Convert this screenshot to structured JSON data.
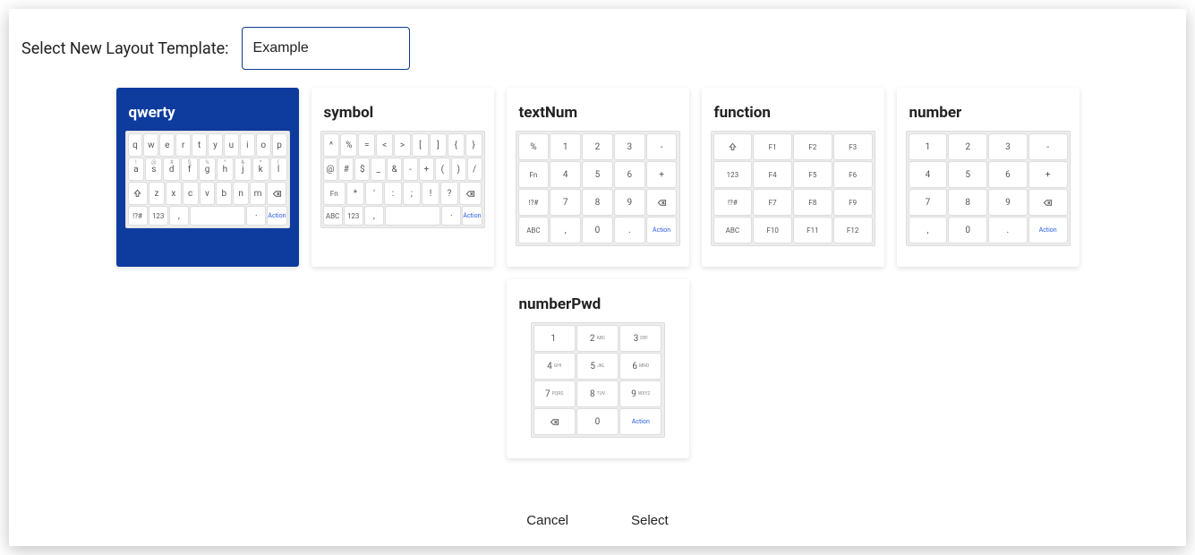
{
  "header": {
    "label": "Select New Layout Template:",
    "input_value": "Example"
  },
  "templates": {
    "qwerty": {
      "title": "qwerty",
      "selected": true,
      "rows": [
        [
          "q",
          "w",
          "e",
          "r",
          "t",
          "y",
          "u",
          "i",
          "o",
          "p"
        ],
        [
          "a",
          "s",
          "d",
          "f",
          "g",
          "h",
          "j",
          "k",
          "l"
        ],
        [
          "⇧",
          "z",
          "x",
          "c",
          "v",
          "b",
          "n",
          "m",
          "⌫"
        ],
        [
          "!?#",
          "123",
          ",",
          "",
          "·",
          "Action"
        ]
      ],
      "sup_row": [
        "!",
        "@",
        "#",
        "$",
        "%",
        "^",
        "&",
        "*",
        "(",
        ")"
      ]
    },
    "symbol": {
      "title": "symbol",
      "rows": [
        [
          "^",
          "%",
          "=",
          "<",
          ">",
          "[",
          "]",
          "{",
          "}"
        ],
        [
          "@",
          "#",
          "$",
          "_",
          "&",
          "-",
          "+",
          "(",
          ")",
          "/"
        ],
        [
          "Fn",
          "*",
          "'",
          ":",
          ";",
          "!",
          "?",
          "⌫"
        ],
        [
          "ABC",
          "123",
          ",",
          "",
          "·",
          "Action"
        ]
      ]
    },
    "textNum": {
      "title": "textNum",
      "rows": [
        [
          "%",
          "1",
          "2",
          "3",
          "-"
        ],
        [
          "Fn",
          "4",
          "5",
          "6",
          "+"
        ],
        [
          "!?#",
          "7",
          "8",
          "9",
          "⌫"
        ],
        [
          "ABC",
          ",",
          "0",
          ".",
          "Action"
        ]
      ]
    },
    "function": {
      "title": "function",
      "rows": [
        [
          "⇧",
          "F1",
          "F2",
          "F3"
        ],
        [
          "123",
          "F4",
          "F5",
          "F6"
        ],
        [
          "!?#",
          "F7",
          "F8",
          "F9"
        ],
        [
          "ABC",
          "F10",
          "F11",
          "F12"
        ]
      ]
    },
    "number": {
      "title": "number",
      "rows": [
        [
          "1",
          "2",
          "3",
          "-"
        ],
        [
          "4",
          "5",
          "6",
          "+"
        ],
        [
          "7",
          "8",
          "9",
          "⌫"
        ],
        [
          ",",
          "0",
          ".",
          "Action"
        ]
      ]
    },
    "numberPwd": {
      "title": "numberPwd",
      "rows": [
        [
          [
            "1",
            ""
          ],
          [
            "2",
            "ABC"
          ],
          [
            "3",
            "DEF"
          ]
        ],
        [
          [
            "4",
            "GHI"
          ],
          [
            "5",
            "JKL"
          ],
          [
            "6",
            "MNO"
          ]
        ],
        [
          [
            "7",
            "PQRS"
          ],
          [
            "8",
            "TUV"
          ],
          [
            "9",
            "WXYZ"
          ]
        ],
        [
          [
            "⌫",
            ""
          ],
          [
            "0",
            ""
          ],
          [
            "Action",
            ""
          ]
        ]
      ]
    }
  },
  "footer": {
    "cancel": "Cancel",
    "select": "Select"
  }
}
